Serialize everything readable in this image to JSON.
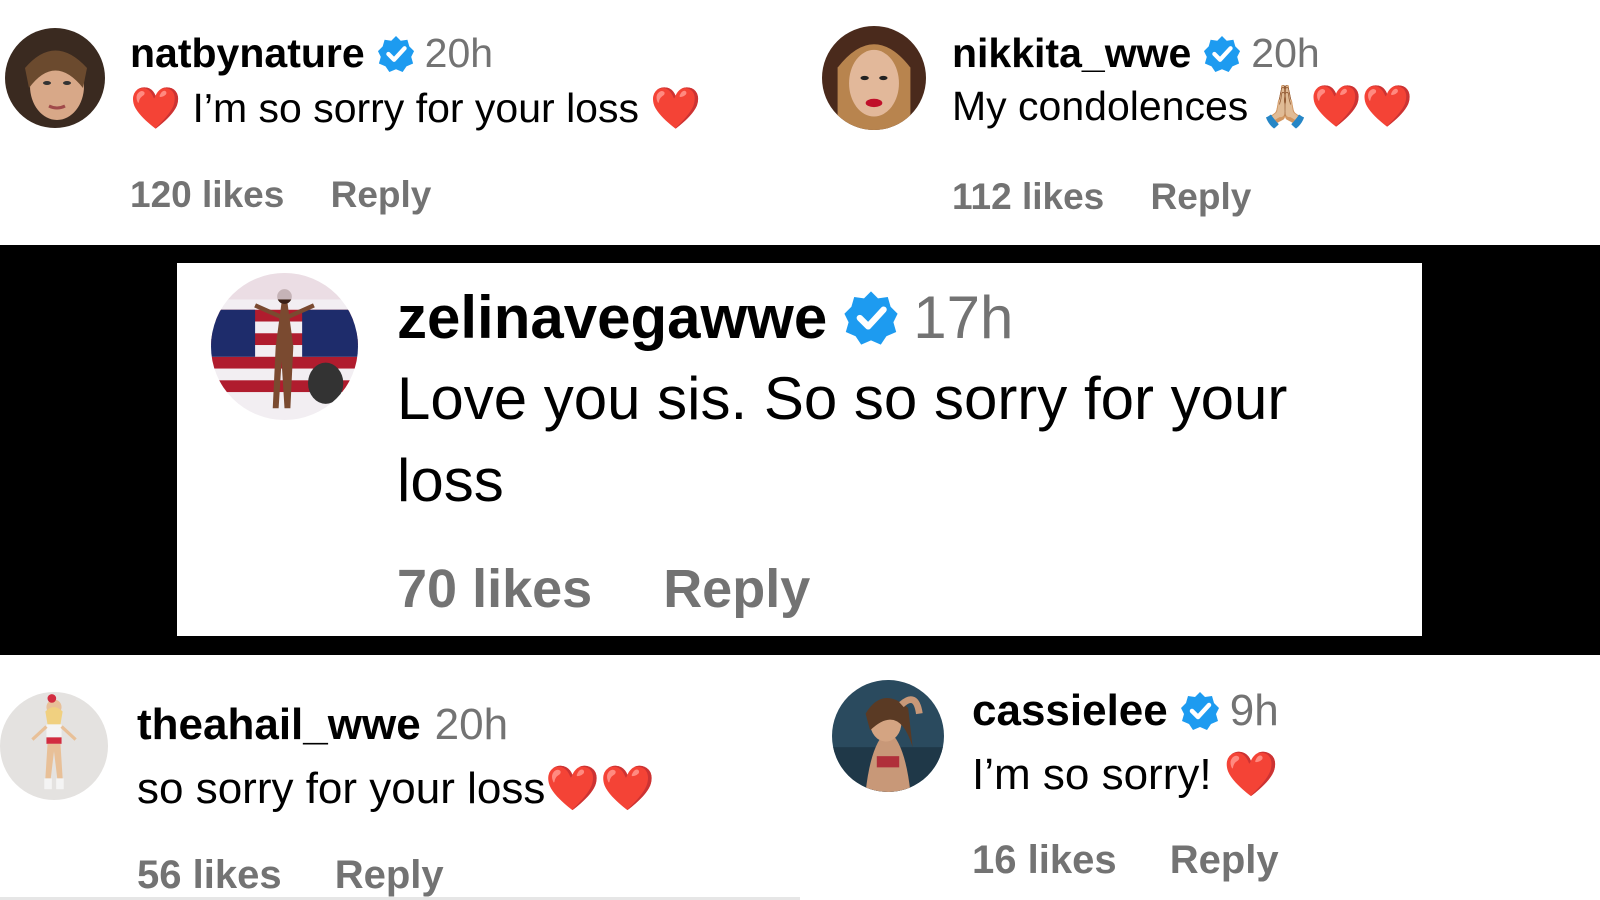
{
  "colors": {
    "verified": "#1d9bf0",
    "meta_gray": "#737373",
    "heart": "#e0161e"
  },
  "comments": [
    {
      "username": "natbynature",
      "verified": true,
      "time": "20h",
      "text_prefix": "❤️",
      "text": " I’m so sorry for your loss ",
      "text_suffix": "❤️",
      "likes": "120 likes",
      "reply": "Reply"
    },
    {
      "username": "nikkita_wwe",
      "verified": true,
      "time": "20h",
      "text": "My condolences ",
      "text_suffix": "🙏🏼❤️❤️",
      "likes": "112 likes",
      "reply": "Reply"
    },
    {
      "username": "zelinavegawwe",
      "verified": true,
      "time": "17h",
      "text_line1": "Love you sis. So so sorry for your",
      "text_line2": "loss",
      "likes": "70 likes",
      "reply": "Reply"
    },
    {
      "username": "theahail_wwe",
      "verified": false,
      "time": "20h",
      "text": "so sorry for your loss",
      "text_suffix": "❤️❤️",
      "likes": "56 likes",
      "reply": "Reply"
    },
    {
      "username": "cassielee",
      "verified": true,
      "time": "9h",
      "text": "I’m so sorry! ",
      "text_suffix": "❤️",
      "likes": "16 likes",
      "reply": "Reply"
    }
  ]
}
